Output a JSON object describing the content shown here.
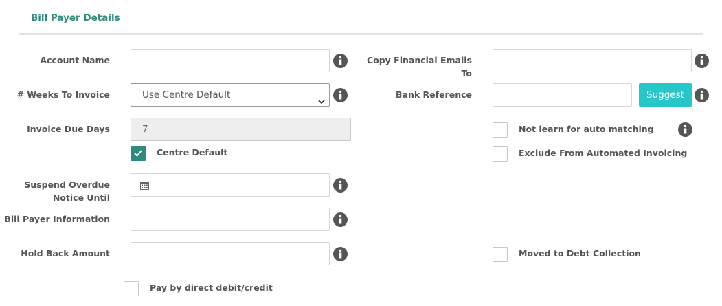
{
  "section": {
    "title": "Bill Payer Details"
  },
  "fields": {
    "account_name": {
      "label": "Account Name",
      "value": ""
    },
    "weeks_to_invoice": {
      "label": "# Weeks To Invoice",
      "selected": "Use Centre Default"
    },
    "invoice_due_days": {
      "label": "Invoice Due Days",
      "value": "7"
    },
    "centre_default": {
      "label": "Centre Default",
      "checked": true
    },
    "suspend_overdue": {
      "label_line1": "Suspend Overdue",
      "label_line2": "Notice Until",
      "value": ""
    },
    "bill_payer_info": {
      "label": "Bill Payer Information",
      "value": ""
    },
    "hold_back_amount": {
      "label": "Hold Back Amount",
      "value": ""
    },
    "pay_by_direct_debit": {
      "label": "Pay by direct debit/credit",
      "checked": false
    },
    "copy_financial_emails": {
      "label_line1": "Copy Financial Emails",
      "label_line2": "To",
      "value": ""
    },
    "bank_reference": {
      "label": "Bank Reference",
      "value": "",
      "suggest_label": "Suggest"
    },
    "not_learn_auto_matching": {
      "label": "Not learn for auto matching",
      "checked": false
    },
    "exclude_automated_invoicing": {
      "label": "Exclude From Automated Invoicing",
      "checked": false
    },
    "moved_to_debt_collection": {
      "label": "Moved to Debt Collection",
      "checked": false
    }
  },
  "icons": {
    "info": "info-circle-icon",
    "calendar": "calendar-icon",
    "caret": "chevron-down-icon",
    "check": "check-icon"
  },
  "colors": {
    "accent": "#2e8b7e",
    "button": "#26c6c9",
    "info_icon": "#555555"
  }
}
